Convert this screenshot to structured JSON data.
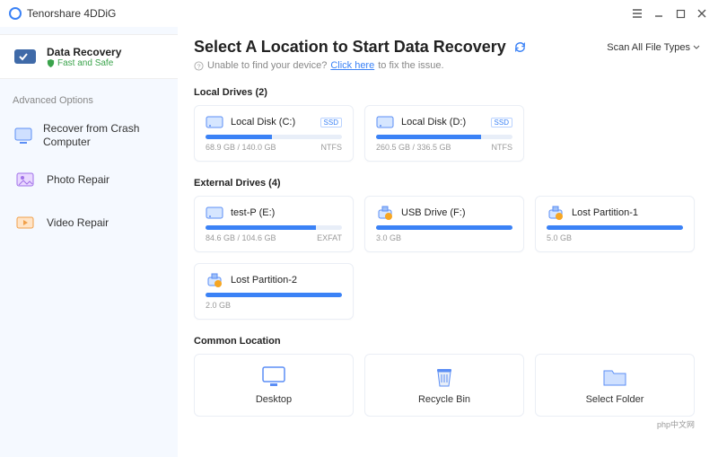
{
  "titlebar": {
    "app_name": "Tenorshare 4DDiG"
  },
  "sidebar": {
    "main": {
      "title": "Data Recovery",
      "subtitle": "Fast and Safe"
    },
    "adv_label": "Advanced Options",
    "items": [
      {
        "label": "Recover from Crash Computer",
        "icon": "recover"
      },
      {
        "label": "Photo Repair",
        "icon": "photo"
      },
      {
        "label": "Video Repair",
        "icon": "video"
      }
    ]
  },
  "main": {
    "title": "Select A Location to Start Data Recovery",
    "scan_link": "Scan All File Types",
    "hint_prefix": "Unable to find your device?",
    "hint_link": "Click here",
    "hint_suffix": "to fix the issue."
  },
  "sections": {
    "local": {
      "title": "Local Drives (2)"
    },
    "external": {
      "title": "External Drives (4)"
    },
    "common": {
      "title": "Common Location"
    }
  },
  "drives": {
    "local": [
      {
        "name": "Local Disk (C:)",
        "badge": "SSD",
        "fill": 49,
        "stats": "68.9 GB / 140.0 GB",
        "fs": "NTFS"
      },
      {
        "name": "Local Disk (D:)",
        "badge": "SSD",
        "fill": 77,
        "stats": "260.5 GB / 336.5 GB",
        "fs": "NTFS"
      }
    ],
    "external": [
      {
        "name": "test-P (E:)",
        "badge": "",
        "fill": 81,
        "stats": "84.6 GB / 104.6 GB",
        "fs": "EXFAT",
        "warn": false,
        "usb": false
      },
      {
        "name": "USB Drive (F:)",
        "badge": "",
        "fill": 100,
        "stats": "3.0 GB",
        "fs": "",
        "warn": true,
        "usb": true
      },
      {
        "name": "Lost Partition-1",
        "badge": "",
        "fill": 100,
        "stats": "5.0 GB",
        "fs": "",
        "warn": true,
        "usb": true
      },
      {
        "name": "Lost Partition-2",
        "badge": "",
        "fill": 100,
        "stats": "2.0 GB",
        "fs": "",
        "warn": true,
        "usb": true
      }
    ]
  },
  "locations": [
    {
      "label": "Desktop",
      "icon": "desktop"
    },
    {
      "label": "Recycle Bin",
      "icon": "bin"
    },
    {
      "label": "Select Folder",
      "icon": "folder"
    }
  ],
  "footer": {
    "brand": "php中文网"
  }
}
